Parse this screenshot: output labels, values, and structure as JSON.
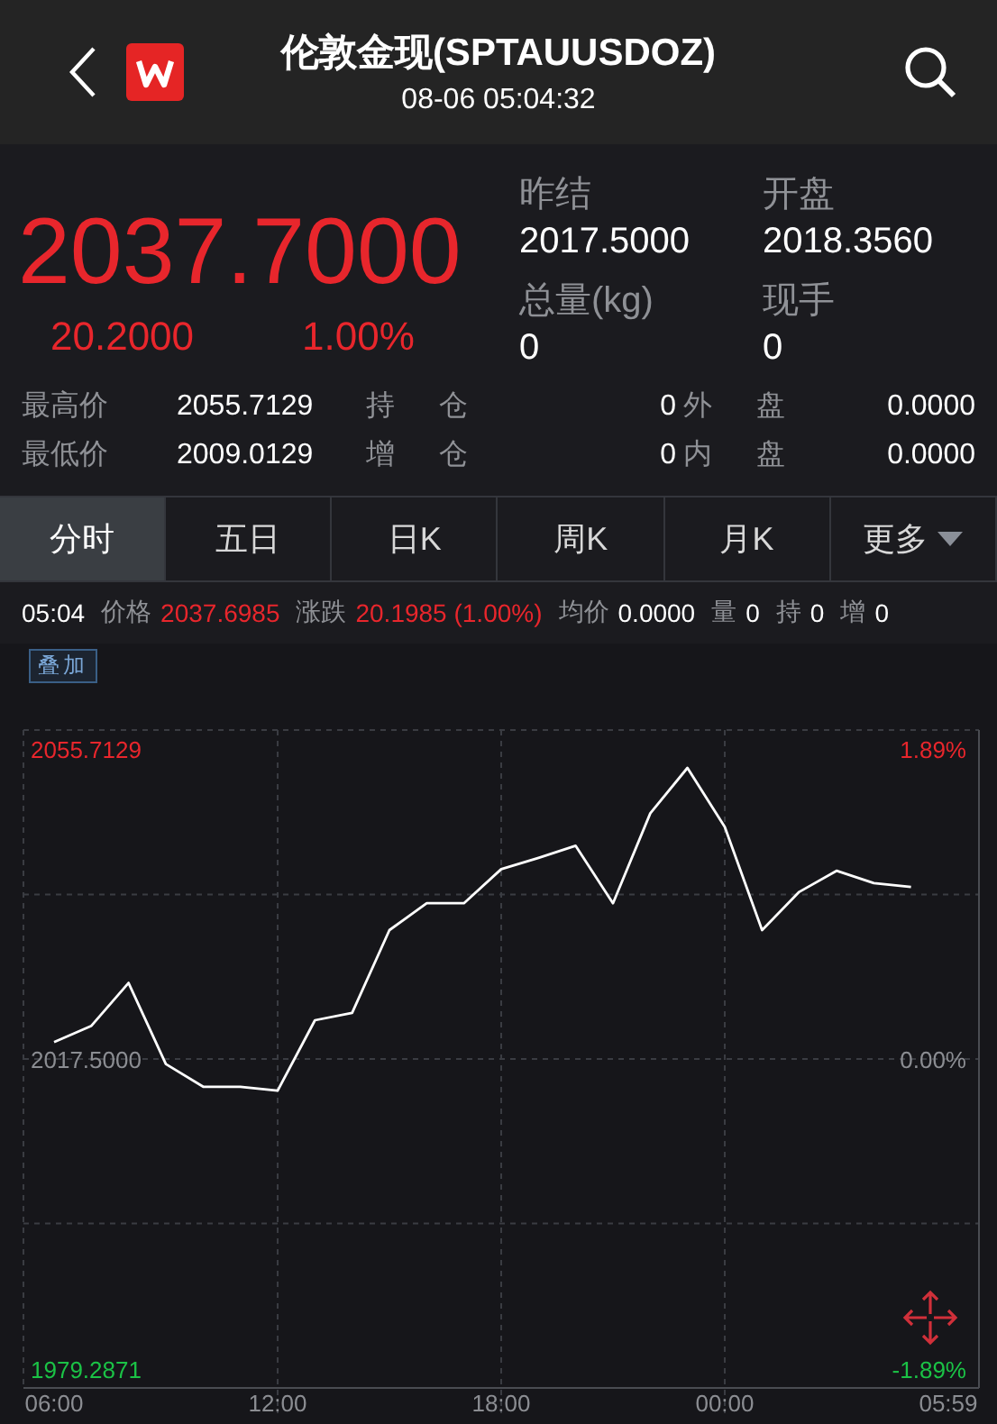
{
  "header": {
    "title": "伦敦金现(SPTAUUSDOZ)",
    "time": "08-06 05:04:32"
  },
  "quote": {
    "price": "2037.7000",
    "change": "20.2000",
    "change_pct": "1.00%",
    "color": "#e8262c",
    "fields": [
      {
        "label": "昨结",
        "value": "2017.5000"
      },
      {
        "label": "开盘",
        "value": "2018.3560"
      },
      {
        "label": "总量(kg)",
        "value": "0"
      },
      {
        "label": "现手",
        "value": "0"
      }
    ]
  },
  "stats": [
    [
      {
        "label": "最高价",
        "value": "2055.7129"
      },
      {
        "label": "持 仓",
        "value": "0"
      },
      {
        "label": "外 盘",
        "value": "0.0000"
      }
    ],
    [
      {
        "label": "最低价",
        "value": "2009.0129"
      },
      {
        "label": "增 仓",
        "value": "0"
      },
      {
        "label": "内 盘",
        "value": "0.0000"
      }
    ]
  ],
  "tabs": [
    {
      "label": "分时",
      "selected": true,
      "kind": "plain"
    },
    {
      "label": "五日",
      "selected": false,
      "kind": "plain"
    },
    {
      "label": "日K",
      "selected": false,
      "kind": "plain"
    },
    {
      "label": "周K",
      "selected": false,
      "kind": "plain"
    },
    {
      "label": "月K",
      "selected": false,
      "kind": "plain"
    },
    {
      "label": "更多",
      "selected": false,
      "kind": "menu"
    }
  ],
  "info_bar": {
    "time": "05:04",
    "items": [
      {
        "label": "价格",
        "value": "2037.6985",
        "color": "#e8262c"
      },
      {
        "label": "涨跌",
        "value": "20.1985 (1.00%)",
        "color": "#e8262c"
      },
      {
        "label": "均价",
        "value": "0.0000",
        "color": "#ffffff"
      },
      {
        "label": "量",
        "value": "0",
        "color": "#ffffff"
      },
      {
        "label": "持",
        "value": "0",
        "color": "#ffffff"
      },
      {
        "label": "增",
        "value": "0",
        "color": "#ffffff"
      }
    ]
  },
  "chart": {
    "overlay_button": "叠加",
    "right_labels": [
      {
        "label": "1.89%",
        "color": "#e8262c"
      },
      {
        "label": "0.00%",
        "color": "#8b8d92"
      },
      {
        "label": "-1.89%",
        "color": "#1bc246"
      }
    ],
    "chart_data": {
      "type": "line",
      "categories": [
        "06:00",
        null,
        null,
        null,
        null,
        null,
        "12:00",
        null,
        null,
        null,
        null,
        null,
        "18:00",
        null,
        null,
        null,
        null,
        null,
        "00:00",
        null,
        null,
        null,
        null,
        null,
        "05:59"
      ],
      "series": [
        {
          "color": "#ffffff",
          "values": [
            2019.7,
            2021.7,
            2027.0,
            2017.0,
            2014.2,
            2014.2,
            2013.7,
            2022.4,
            2023.3,
            2033.5,
            2036.8,
            2036.8,
            2041.0,
            2042.4,
            2043.9,
            2036.8,
            2047.9,
            2053.5,
            2046.2,
            2033.5,
            2038.2,
            2040.8,
            2039.3,
            2038.8,
            null
          ]
        }
      ],
      "ylim": [
        1977.07,
        2058.16
      ],
      "grid": true,
      "yticks": [
        {
          "value": 2055.7129,
          "label": "2055.7129"
        },
        {
          "value": 2017.5,
          "label": "2017.5000"
        },
        {
          "value": 1979.2871,
          "label": "1979.2871"
        }
      ]
    }
  }
}
